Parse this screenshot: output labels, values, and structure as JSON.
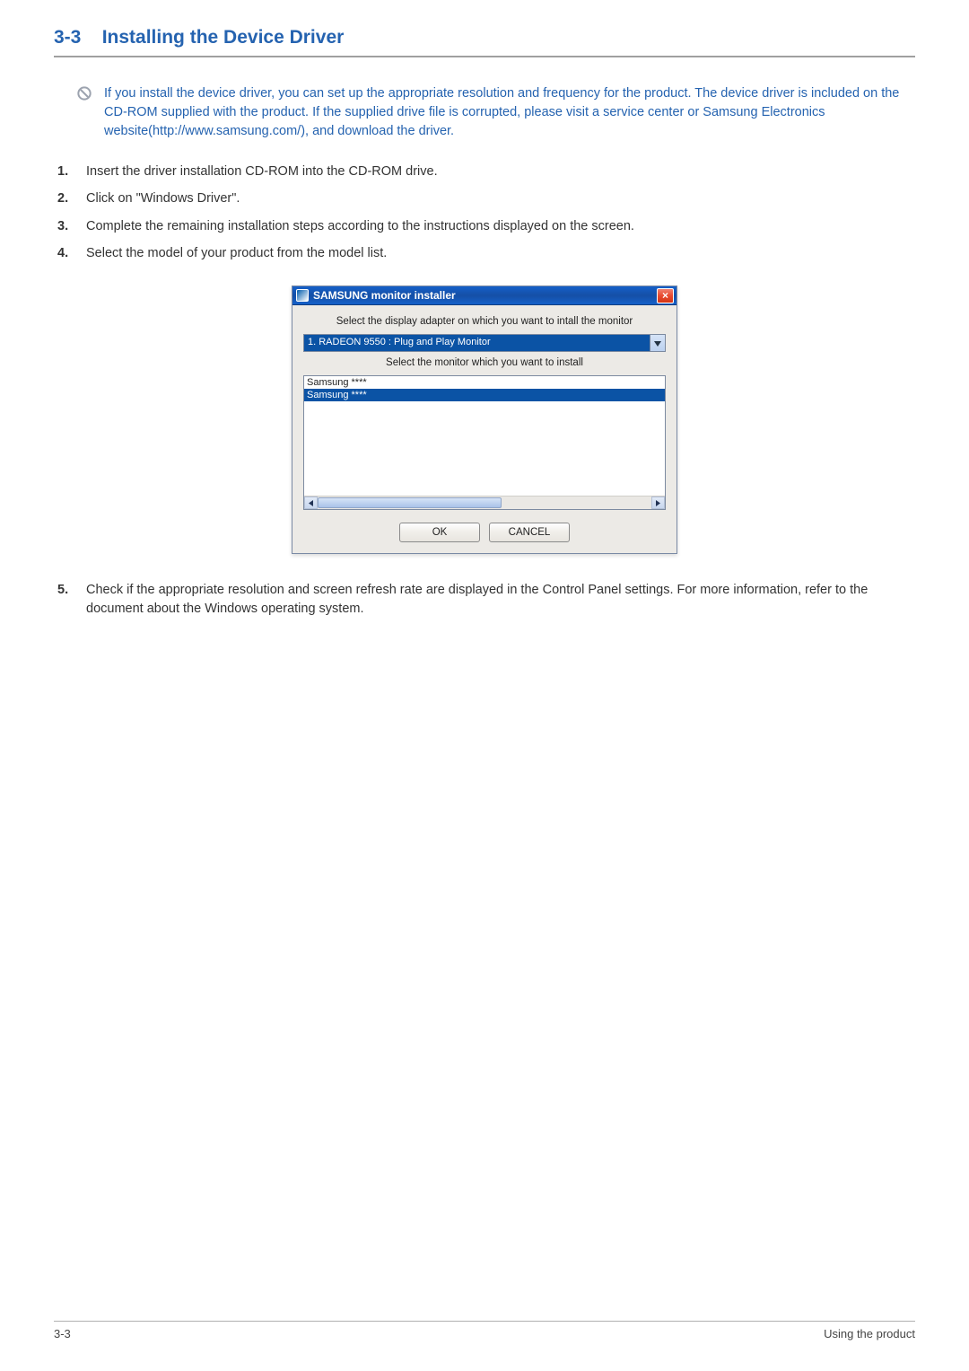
{
  "section": {
    "number": "3-3",
    "title": "Installing the Device Driver"
  },
  "note": "If you install the device driver, you can set up the appropriate resolution and frequency for the product. The device driver is included on the CD-ROM supplied with the product. If the supplied drive file is corrupted, please visit a service center or Samsung Electronics website(http://www.samsung.com/), and download the driver.",
  "steps": [
    "Insert the driver installation CD-ROM into the CD-ROM drive.",
    "Click on \"Windows Driver\".",
    "Complete the remaining installation steps according to the instructions displayed on the screen.",
    "Select the model of your product from the model list."
  ],
  "installer": {
    "title": "SAMSUNG monitor installer",
    "prompt1": "Select the display adapter on which you want to intall the monitor",
    "dropdown": "1. RADEON 9550 : Plug and Play Monitor",
    "prompt2": "Select the monitor which you want to install",
    "list": [
      "Samsung ****",
      "Samsung ****"
    ],
    "ok": "OK",
    "cancel": "CANCEL"
  },
  "step5_num": "5.",
  "step5": "Check if the appropriate resolution and screen refresh rate are displayed in the Control Panel settings. For more information, refer to the document about the Windows operating system.",
  "footer": {
    "left": "3-3",
    "right": "Using the product"
  }
}
